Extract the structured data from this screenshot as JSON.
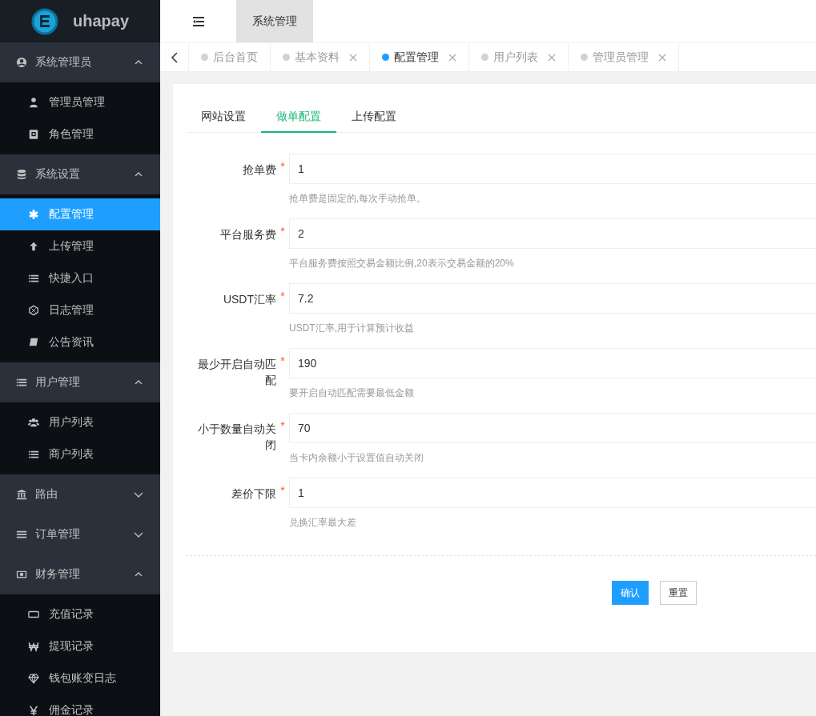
{
  "brand": {
    "name": "uhapay"
  },
  "sidebar": {
    "groups": [
      {
        "label": "系统管理员",
        "expanded": true,
        "items": [
          {
            "label": "管理员管理",
            "selected": false
          },
          {
            "label": "角色管理",
            "selected": false
          }
        ]
      },
      {
        "label": "系统设置",
        "expanded": true,
        "items": [
          {
            "label": "配置管理",
            "selected": true
          },
          {
            "label": "上传管理",
            "selected": false
          },
          {
            "label": "快捷入口",
            "selected": false
          },
          {
            "label": "日志管理",
            "selected": false
          },
          {
            "label": "公告资讯",
            "selected": false
          }
        ]
      },
      {
        "label": "用户管理",
        "expanded": true,
        "items": [
          {
            "label": "用户列表",
            "selected": false
          },
          {
            "label": "商户列表",
            "selected": false
          }
        ]
      },
      {
        "label": "路由",
        "expanded": false
      },
      {
        "label": "订单管理",
        "expanded": false
      },
      {
        "label": "财务管理",
        "expanded": true,
        "items": [
          {
            "label": "充值记录",
            "selected": false
          },
          {
            "label": "提现记录",
            "selected": false
          },
          {
            "label": "钱包账变日志",
            "selected": false
          },
          {
            "label": "佣金记录",
            "selected": false
          }
        ]
      }
    ]
  },
  "header": {
    "tabs": [
      {
        "label": "系统管理",
        "selected": true
      }
    ]
  },
  "page_tabs": [
    {
      "label": "后台首页",
      "selected": false,
      "closable": false
    },
    {
      "label": "基本资料",
      "selected": false,
      "closable": true
    },
    {
      "label": "配置管理",
      "selected": true,
      "closable": true
    },
    {
      "label": "用户列表",
      "selected": false,
      "closable": true
    },
    {
      "label": "管理员管理",
      "selected": false,
      "closable": true
    }
  ],
  "form": {
    "tabs": [
      {
        "label": "网站设置",
        "selected": false
      },
      {
        "label": "做单配置",
        "selected": true
      },
      {
        "label": "上传配置",
        "selected": false
      }
    ],
    "fields": [
      {
        "label": "抢单费",
        "required_mark": "*",
        "value": "1",
        "hint": "抢单费是固定的,每次手动抢单。"
      },
      {
        "label": "平台服务费",
        "required_mark": "*",
        "value": "2",
        "hint": "平台服务费按照交易金额比例,20表示交易金额的20%"
      },
      {
        "label": "USDT汇率",
        "required_mark": "*",
        "value": "7.2",
        "hint": "USDT汇率,用于计算预计收益"
      },
      {
        "label": "最少开启自动匹配",
        "required_mark": "*",
        "value": "190",
        "hint": "要开启自动匹配需要最低金额"
      },
      {
        "label": "小于数量自动关闭",
        "required_mark": "*",
        "value": "70",
        "hint": "当卡内余额小于设置值自动关闭"
      },
      {
        "label": "差价下限",
        "required_mark": "*",
        "value": "1",
        "hint": "兑换汇率最大差"
      }
    ],
    "buttons": [
      {
        "label": "确认",
        "kind": "primary"
      },
      {
        "label": "重置",
        "kind": "default"
      }
    ]
  }
}
